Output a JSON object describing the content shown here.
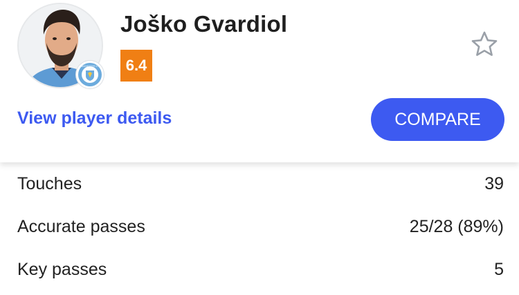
{
  "player": {
    "name": "Joško Gvardiol",
    "rating": "6.4",
    "avatar_icon": "player-avatar-icon",
    "club_badge_icon": "manchester-city-badge-icon",
    "club_badge_text": "MANCHESTER CITY"
  },
  "actions": {
    "view_details_label": "View player details",
    "compare_label": "COMPARE",
    "favorite_icon": "star-outline-icon"
  },
  "stats": [
    {
      "label": "Touches",
      "value": "39"
    },
    {
      "label": "Accurate passes",
      "value": "25/28 (89%)"
    },
    {
      "label": "Key passes",
      "value": "5"
    }
  ],
  "colors": {
    "accent_blue": "#3d5af1",
    "rating_orange": "#f07f14",
    "text": "#222222",
    "star_gray": "#9aa0a8",
    "badge_blue": "#6cabdd"
  }
}
